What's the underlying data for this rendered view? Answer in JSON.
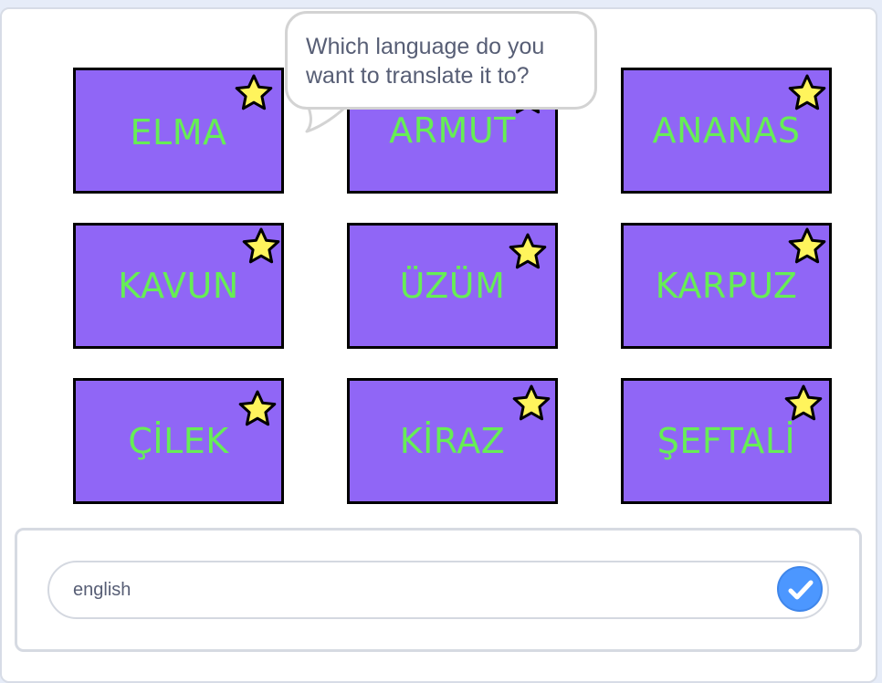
{
  "speech_bubble": {
    "text": "Which language do you want to translate it to?"
  },
  "cards": [
    {
      "label": "ELMA"
    },
    {
      "label": "ARMUT"
    },
    {
      "label": "ANANAS"
    },
    {
      "label": "KAVUN"
    },
    {
      "label": "ÜZÜM"
    },
    {
      "label": "KARPUZ"
    },
    {
      "label": "ÇİLEK"
    },
    {
      "label": "KİRAZ"
    },
    {
      "label": "ŞEFTALİ"
    }
  ],
  "answer": {
    "value": "english",
    "submit_icon": "check-icon"
  },
  "colors": {
    "card_fill": "#9066f6",
    "card_text": "#66ee55",
    "star_fill": "#fff45c",
    "submit_button": "#4c97ff"
  }
}
